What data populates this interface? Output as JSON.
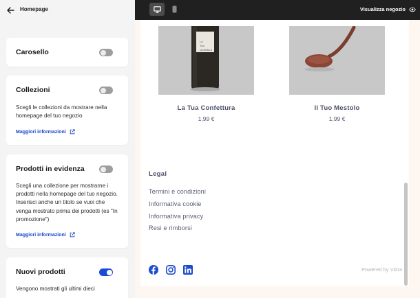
{
  "sidebar": {
    "header_title": "Homepage",
    "sections": [
      {
        "title": "Carosello",
        "enabled": false
      },
      {
        "title": "Collezioni",
        "enabled": false,
        "description": "Scegli le collezioni da mostrare nella homepage del tuo negozio",
        "link": "Maggiori informazioni"
      },
      {
        "title": "Prodotti in evidenza",
        "enabled": false,
        "description": "Scegli una collezione per mostrarne i prodotti nella homepage del tuo negozio. Inserisci anche un titolo se vuoi che venga mostrato prima dei prodotti (es \"In promozione\")",
        "link": "Maggiori informazioni"
      },
      {
        "title": "Nuovi prodotti",
        "enabled": true,
        "description": "Vengono mostrati gli ultimi dieci"
      }
    ]
  },
  "topbar": {
    "visit_store_label": "Visualizza negozio",
    "active_view": "desktop"
  },
  "preview": {
    "products": [
      {
        "name": "La Tua Confettura",
        "price": "1,99 €",
        "jar_label": "La Tua confettura"
      },
      {
        "name": "Il Tuo Mestolo",
        "price": "1,99 €"
      }
    ],
    "legal": {
      "title": "Legal",
      "links": [
        "Termini e condizioni",
        "Informativa cookie",
        "Informativa privacy",
        "Resi e rimborsi"
      ]
    },
    "social_icons": [
      "facebook-icon",
      "instagram-icon",
      "linkedin-icon"
    ],
    "powered_by": "Powered by Vidra"
  },
  "colors": {
    "accent": "#1a4ad6",
    "link": "#1846c9",
    "topbar": "#202020",
    "panel": "#f4f4f4",
    "preview_frame": "#fdf6f1",
    "social_blue": "#1c4dce"
  }
}
